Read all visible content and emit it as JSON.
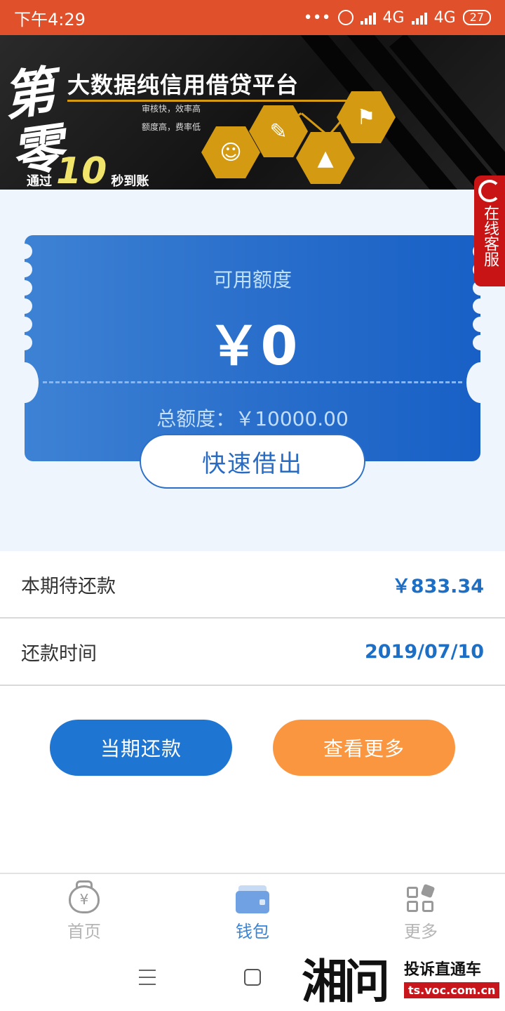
{
  "status_bar": {
    "time": "下午4:29",
    "dots": "•••",
    "network1": "4G",
    "network2": "4G",
    "battery": "27"
  },
  "banner": {
    "logo_text": "第零",
    "headline": "大数据纯信用借贷平台",
    "line1": "审核快，效率高",
    "line2": "额度高，费率低",
    "tagline_prefix": "通过",
    "tagline_number": "10",
    "tagline_suffix": "秒到账",
    "accent_color": "#d69a12"
  },
  "service_tab": {
    "label": "在线客服"
  },
  "credit_card": {
    "available_label": "可用额度",
    "available_amount": "￥0",
    "total_label": "总额度：￥10000.00",
    "borrow_button": "快速借出"
  },
  "repayment": {
    "due_label": "本期待还款",
    "due_value": "￥833.34",
    "date_label": "还款时间",
    "date_value": "2019/07/10"
  },
  "actions": {
    "repay_button": "当期还款",
    "more_button": "查看更多"
  },
  "tabbar": {
    "items": [
      {
        "label": "首页",
        "icon": "money-bag-icon",
        "active": false
      },
      {
        "label": "钱包",
        "icon": "wallet-icon",
        "active": true
      },
      {
        "label": "更多",
        "icon": "grid-icon",
        "active": false
      }
    ]
  },
  "watermark": {
    "logo": "湘问",
    "title": "投诉直通车",
    "url": "ts.voc.com.cn"
  },
  "colors": {
    "status_bar": "#e0512b",
    "primary_blue": "#1f76d2",
    "orange": "#fb9640",
    "service_red": "#c81414"
  }
}
